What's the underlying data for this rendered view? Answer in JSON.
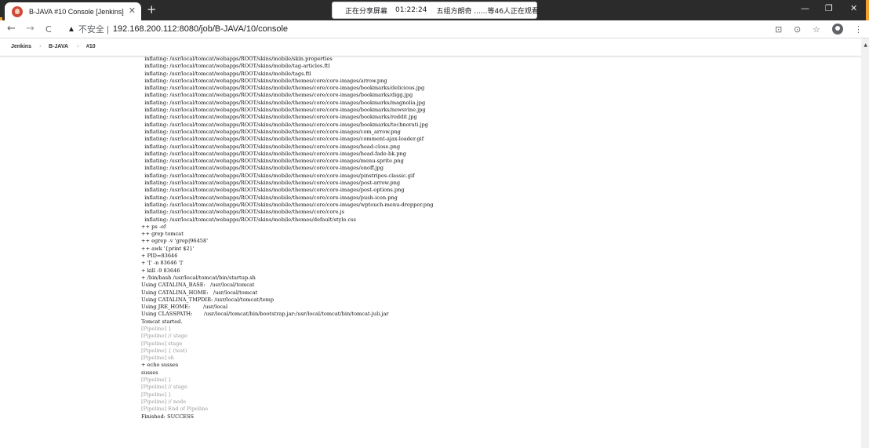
{
  "browser": {
    "tab_title": "B-JAVA #10 Console [Jenkins]",
    "tab_close": "✕",
    "new_tab": "+",
    "share_banner": {
      "status": "正在分享屏幕",
      "time": "01:22:24",
      "viewers": "五组方朗奇 ......等46人正在观看"
    },
    "window_controls": {
      "minimize": "—",
      "maximize": "❐",
      "close": "✕"
    },
    "nav": {
      "back": "←",
      "forward": "→",
      "reload": "C"
    },
    "omnibox": {
      "warning_icon": "▲",
      "security": "不安全 |",
      "url": "192.168.200.112:8080/job/B-JAVA/10/console"
    },
    "tool_icons": {
      "translate": "⊡",
      "zoom": "⊙",
      "star": "☆",
      "menu": "⋮"
    }
  },
  "breadcrumb": {
    "items": [
      "Jenkins",
      "B-JAVA",
      "#10"
    ],
    "separator": "›"
  },
  "console": {
    "lines": [
      {
        "text": "  inflating: /usr/local/tomcat/webapps/ROOT/skins/mobile/skin.properties",
        "pipeline": false
      },
      {
        "text": "  inflating: /usr/local/tomcat/webapps/ROOT/skins/mobile/tag-articles.ftl",
        "pipeline": false
      },
      {
        "text": "  inflating: /usr/local/tomcat/webapps/ROOT/skins/mobile/tags.ftl",
        "pipeline": false
      },
      {
        "text": "  inflating: /usr/local/tomcat/webapps/ROOT/skins/mobile/themes/core/core-images/arrow.png",
        "pipeline": false
      },
      {
        "text": "  inflating: /usr/local/tomcat/webapps/ROOT/skins/mobile/themes/core/core-images/bookmarks/delicious.jpg",
        "pipeline": false
      },
      {
        "text": "  inflating: /usr/local/tomcat/webapps/ROOT/skins/mobile/themes/core/core-images/bookmarks/digg.jpg",
        "pipeline": false
      },
      {
        "text": "  inflating: /usr/local/tomcat/webapps/ROOT/skins/mobile/themes/core/core-images/bookmarks/magnolia.jpg",
        "pipeline": false
      },
      {
        "text": "  inflating: /usr/local/tomcat/webapps/ROOT/skins/mobile/themes/core/core-images/bookmarks/newsvine.jpg",
        "pipeline": false
      },
      {
        "text": "  inflating: /usr/local/tomcat/webapps/ROOT/skins/mobile/themes/core/core-images/bookmarks/reddit.jpg",
        "pipeline": false
      },
      {
        "text": "  inflating: /usr/local/tomcat/webapps/ROOT/skins/mobile/themes/core/core-images/bookmarks/technorati.jpg",
        "pipeline": false
      },
      {
        "text": "  inflating: /usr/local/tomcat/webapps/ROOT/skins/mobile/themes/core/core-images/com_arrow.png",
        "pipeline": false
      },
      {
        "text": "  inflating: /usr/local/tomcat/webapps/ROOT/skins/mobile/themes/core/core-images/comment-ajax-loader.gif",
        "pipeline": false
      },
      {
        "text": "  inflating: /usr/local/tomcat/webapps/ROOT/skins/mobile/themes/core/core-images/head-close.png",
        "pipeline": false
      },
      {
        "text": "  inflating: /usr/local/tomcat/webapps/ROOT/skins/mobile/themes/core/core-images/head-fade-bk.png",
        "pipeline": false
      },
      {
        "text": "  inflating: /usr/local/tomcat/webapps/ROOT/skins/mobile/themes/core/core-images/menu-sprite.png",
        "pipeline": false
      },
      {
        "text": "  inflating: /usr/local/tomcat/webapps/ROOT/skins/mobile/themes/core/core-images/onoff.jpg",
        "pipeline": false
      },
      {
        "text": "  inflating: /usr/local/tomcat/webapps/ROOT/skins/mobile/themes/core/core-images/pinstripes-classic.gif",
        "pipeline": false
      },
      {
        "text": "  inflating: /usr/local/tomcat/webapps/ROOT/skins/mobile/themes/core/core-images/post-arrow.png",
        "pipeline": false
      },
      {
        "text": "  inflating: /usr/local/tomcat/webapps/ROOT/skins/mobile/themes/core/core-images/post-options.png",
        "pipeline": false
      },
      {
        "text": "  inflating: /usr/local/tomcat/webapps/ROOT/skins/mobile/themes/core/core-images/push-icon.png",
        "pipeline": false
      },
      {
        "text": "  inflating: /usr/local/tomcat/webapps/ROOT/skins/mobile/themes/core/core-images/wptouch-menu-dropper.png",
        "pipeline": false
      },
      {
        "text": "  inflating: /usr/local/tomcat/webapps/ROOT/skins/mobile/themes/core/core.js",
        "pipeline": false
      },
      {
        "text": "  inflating: /usr/local/tomcat/webapps/ROOT/skins/mobile/themes/default/style.css",
        "pipeline": false
      },
      {
        "text": "++ ps -ef",
        "pipeline": false
      },
      {
        "text": "++ grep tomcat",
        "pipeline": false
      },
      {
        "text": "++ egrep -v 'grep|96458'",
        "pipeline": false
      },
      {
        "text": "++ awk '{print $2}'",
        "pipeline": false
      },
      {
        "text": "+ PID=83646",
        "pipeline": false
      },
      {
        "text": "+ '[' -n 83646 ']'",
        "pipeline": false
      },
      {
        "text": "+ kill -9 83646",
        "pipeline": false
      },
      {
        "text": "+ /bin/bash /usr/local/tomcat/bin/startup.sh",
        "pipeline": false
      },
      {
        "text": "Using CATALINA_BASE:   /usr/local/tomcat",
        "pipeline": false
      },
      {
        "text": "Using CATALINA_HOME:   /usr/local/tomcat",
        "pipeline": false
      },
      {
        "text": "Using CATALINA_TMPDIR: /usr/local/tomcat/temp",
        "pipeline": false
      },
      {
        "text": "Using JRE_HOME:        /usr/local",
        "pipeline": false
      },
      {
        "text": "Using CLASSPATH:       /usr/local/tomcat/bin/bootstrap.jar:/usr/local/tomcat/bin/tomcat-juli.jar",
        "pipeline": false
      },
      {
        "text": "Tomcat started.",
        "pipeline": false
      },
      {
        "text": "[Pipeline] }",
        "pipeline": true
      },
      {
        "text": "[Pipeline] // stage",
        "pipeline": true
      },
      {
        "text": "[Pipeline] stage",
        "pipeline": true
      },
      {
        "text": "[Pipeline] { (test)",
        "pipeline": true
      },
      {
        "text": "[Pipeline] sh",
        "pipeline": true
      },
      {
        "text": "+ echo susses",
        "pipeline": false
      },
      {
        "text": "susses",
        "pipeline": false
      },
      {
        "text": "[Pipeline] }",
        "pipeline": true
      },
      {
        "text": "[Pipeline] // stage",
        "pipeline": true
      },
      {
        "text": "[Pipeline] }",
        "pipeline": true
      },
      {
        "text": "[Pipeline] // node",
        "pipeline": true
      },
      {
        "text": "[Pipeline] End of Pipeline",
        "pipeline": true
      },
      {
        "text": "Finished: SUCCESS",
        "pipeline": false
      }
    ]
  },
  "colors": {
    "titlebar": "#2b2b2b",
    "jenkins_favicon": "#d24939",
    "share_orange": "#f4a031",
    "pipeline_text": "#9a9a9a",
    "console_text": "#111111"
  }
}
